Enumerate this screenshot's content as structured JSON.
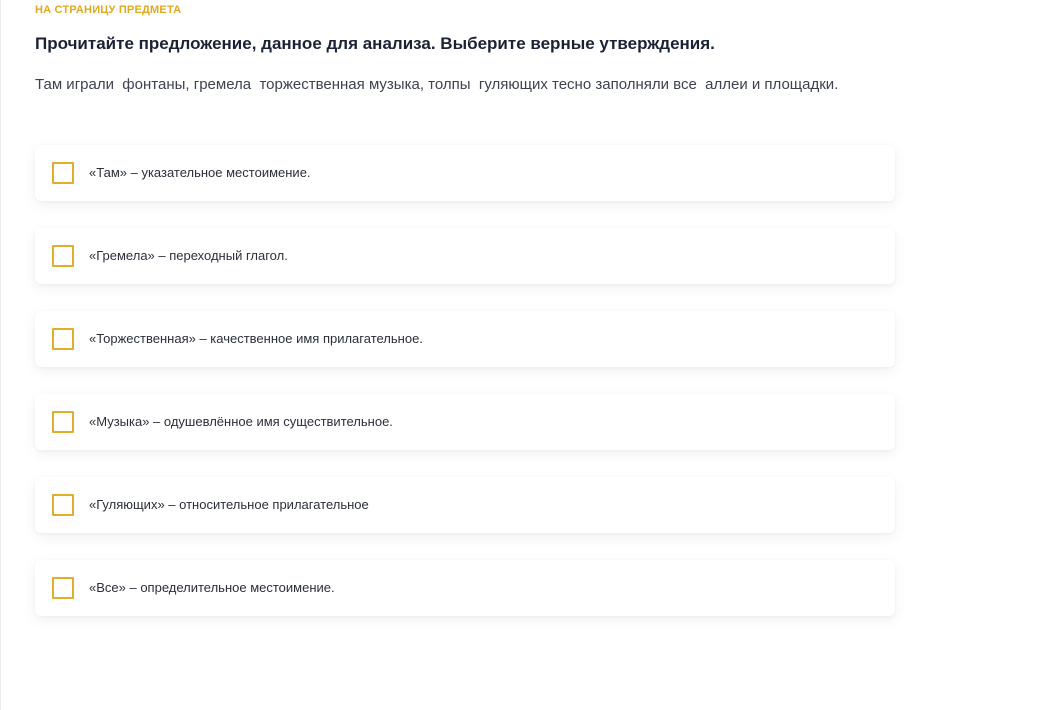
{
  "header": {
    "back_link": "НА СТРАНИЦУ ПРЕДМЕТА"
  },
  "question": {
    "title": "Прочитайте предложение, данное для анализа. Выберите верные утверждения.",
    "sentence": "Там играли  фонтаны, гремела  торжественная музыка, толпы  гуляющих тесно заполняли все  аллеи и площадки."
  },
  "options": [
    {
      "label": "«Там» – указательное местоимение.",
      "checked": false
    },
    {
      "label": "«Гремела» – переходный глагол.",
      "checked": false
    },
    {
      "label": "«Торжественная» – качественное имя прилагательное.",
      "checked": false
    },
    {
      "label": "«Музыка» – одушевлённое имя существительное.",
      "checked": false
    },
    {
      "label": "«Гуляющих» – относительное прилагательное",
      "checked": false
    },
    {
      "label": "«Все» – определительное местоимение.",
      "checked": false
    }
  ],
  "colors": {
    "accent": "#e1ae2b",
    "link": "#e0a91e",
    "title": "#1b2236",
    "text": "#3d4250"
  }
}
